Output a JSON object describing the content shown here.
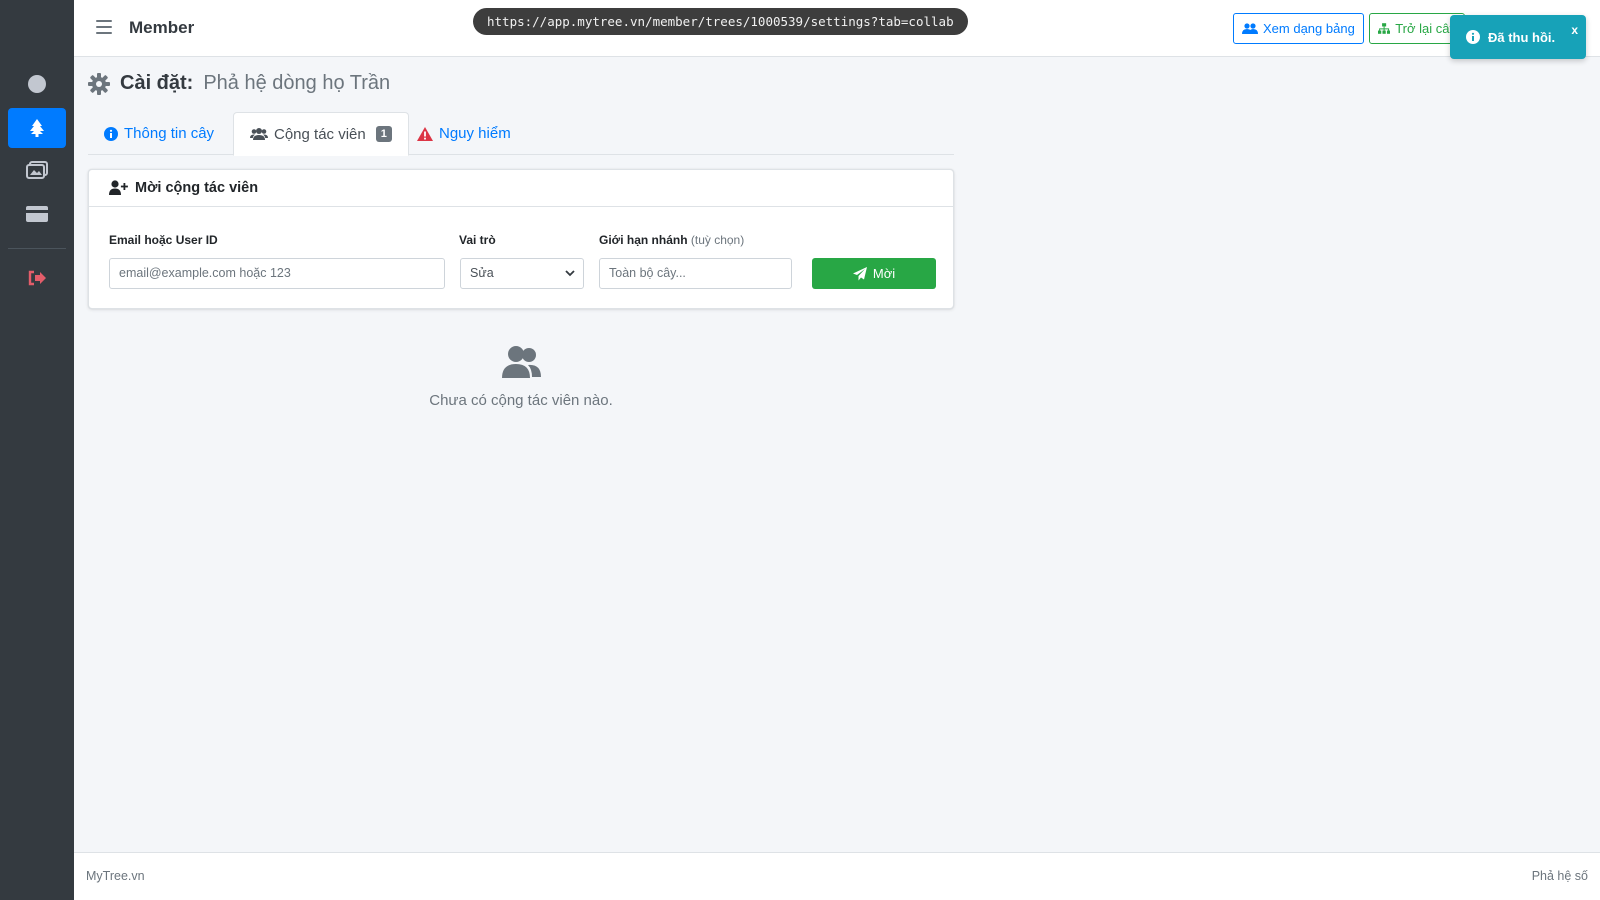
{
  "sidebar": {
    "items": [
      {
        "icon": "user-circle-icon"
      },
      {
        "icon": "tree-icon",
        "active": true
      },
      {
        "icon": "images-icon"
      },
      {
        "icon": "credit-card-icon"
      },
      {
        "icon": "sign-out-icon"
      }
    ]
  },
  "topbar": {
    "brand": "Member",
    "url": "https://app.mytree.vn/member/trees/1000539/settings?tab=collab",
    "table_view_label": "Xem dạng bảng",
    "back_label": "Trở lại cây"
  },
  "toast": {
    "message": "Đã thu hồi.",
    "close_label": "x"
  },
  "page": {
    "title_label": "Cài đặt:",
    "title_value": "Phả hệ dòng họ Trần"
  },
  "tabs": [
    {
      "label": "Thông tin cây",
      "icon": "info-icon"
    },
    {
      "label": "Cộng tác viên",
      "icon": "users-icon",
      "badge": "1",
      "active": true
    },
    {
      "label": "Nguy hiểm",
      "icon": "warning-icon"
    }
  ],
  "invite_card": {
    "header": "Mời cộng tác viên",
    "email_label": "Email hoặc User ID",
    "email_placeholder": "email@example.com hoặc 123",
    "role_label": "Vai trò",
    "role_value": "Sửa",
    "branch_label": "Giới hạn nhánh",
    "branch_optional": "(tuỳ chọn)",
    "branch_placeholder": "Toàn bộ cây...",
    "invite_button": "Mời"
  },
  "empty_state": {
    "message": "Chưa có cộng tác viên nào."
  },
  "footer": {
    "left": "MyTree.vn",
    "right": "Phả hệ số"
  },
  "colors": {
    "primary": "#007bff",
    "success": "#28a745",
    "info": "#17a2b8",
    "danger": "#dc3545",
    "sidebar": "#343a40"
  }
}
